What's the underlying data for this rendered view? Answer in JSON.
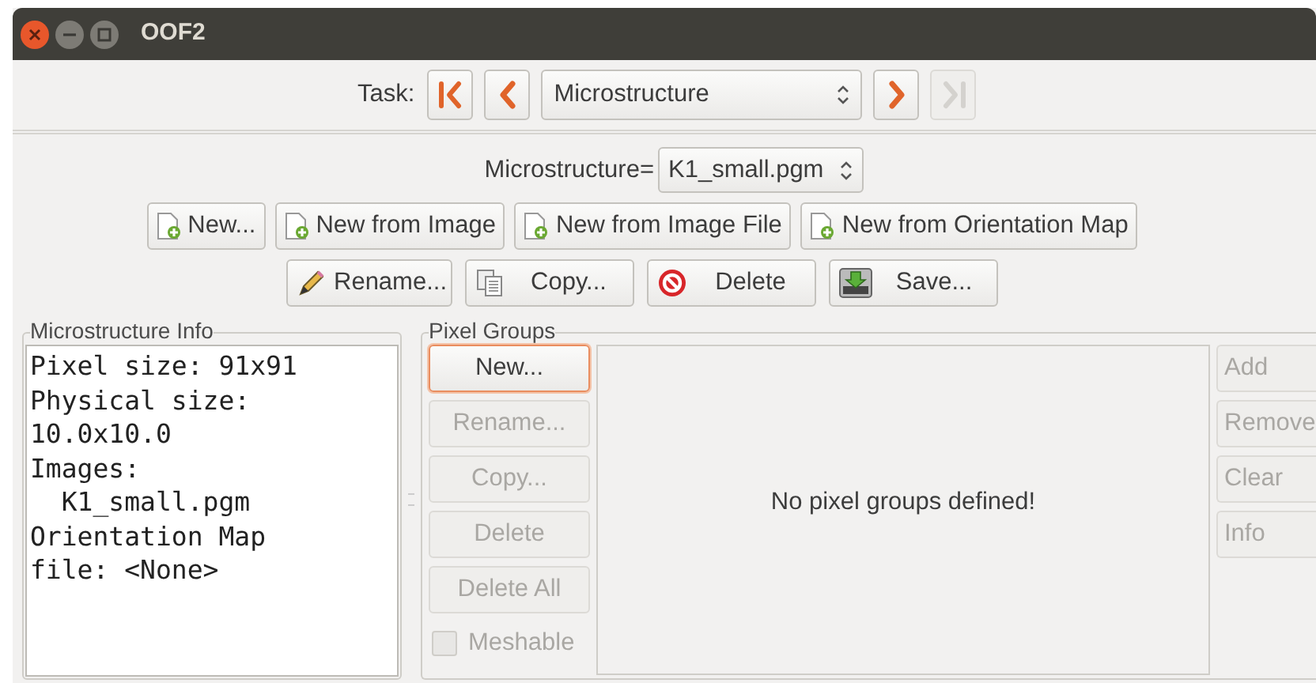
{
  "window": {
    "title": "OOF2"
  },
  "task": {
    "label": "Task:",
    "value": "Microstructure",
    "nav": [
      {
        "kind": "first",
        "disabled": false
      },
      {
        "kind": "prev",
        "disabled": false
      },
      {
        "kind": "next",
        "disabled": false
      },
      {
        "kind": "last",
        "disabled": true
      }
    ]
  },
  "microstructure": {
    "label": "Microstructure=",
    "value": "K1_small.pgm"
  },
  "create_buttons": [
    {
      "label": "New...",
      "kind": "new"
    },
    {
      "label": "New from Image",
      "kind": "new"
    },
    {
      "label": "New from Image File",
      "kind": "new"
    },
    {
      "label": "New from Orientation Map",
      "kind": "new"
    }
  ],
  "edit_buttons": [
    {
      "label": "Rename...",
      "kind": "rename"
    },
    {
      "label": "Copy...",
      "kind": "copy"
    },
    {
      "label": "Delete",
      "kind": "delete"
    },
    {
      "label": "Save...",
      "kind": "save"
    }
  ],
  "info": {
    "title": "Microstructure Info",
    "lines": [
      "Pixel size: 91x91",
      "Physical size:",
      "10.0x10.0",
      "Images:",
      "  K1_small.pgm",
      "Orientation Map",
      "file: <None>"
    ]
  },
  "pixel_groups": {
    "title": "Pixel Groups",
    "buttons": [
      {
        "label": "New...",
        "disabled": false,
        "focused": true
      },
      {
        "label": "Rename...",
        "disabled": true,
        "focused": false
      },
      {
        "label": "Copy...",
        "disabled": true,
        "focused": false
      },
      {
        "label": "Delete",
        "disabled": true,
        "focused": false
      },
      {
        "label": "Delete All",
        "disabled": true,
        "focused": false
      }
    ],
    "meshable": {
      "label": "Meshable",
      "checked": false,
      "disabled": true
    },
    "empty_message": "No pixel groups defined!",
    "side_buttons": [
      {
        "label": "Add",
        "disabled": true
      },
      {
        "label": "Remove",
        "disabled": true
      },
      {
        "label": "Clear",
        "disabled": true
      },
      {
        "label": "Info",
        "disabled": true
      }
    ]
  }
}
